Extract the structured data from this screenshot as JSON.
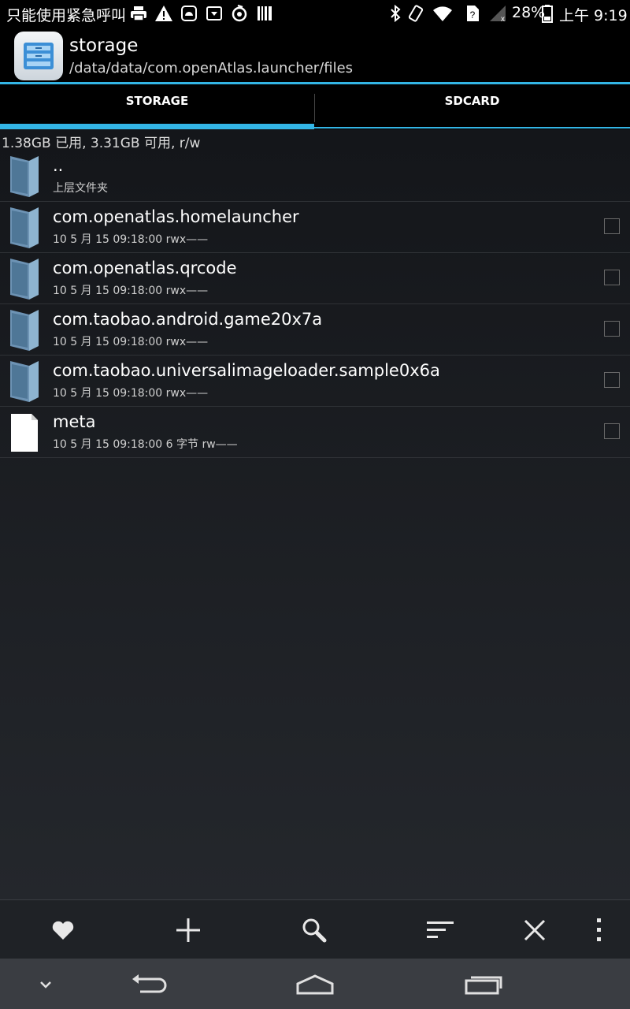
{
  "status_bar": {
    "carrier": "只能使用紧急呼叫",
    "battery": "28%",
    "time": "上午 9:19"
  },
  "action_bar": {
    "title": "storage",
    "path": "/data/data/com.openAtlas.launcher/files"
  },
  "tabs": [
    {
      "label": "STORAGE",
      "selected": true
    },
    {
      "label": "SDCARD",
      "selected": false
    }
  ],
  "storage_info": "1.38GB 已用, 3.31GB 可用, r/w",
  "files": [
    {
      "name": "..",
      "meta": "上层文件夹",
      "type": "folder",
      "checkbox": false
    },
    {
      "name": "com.openatlas.homelauncher",
      "meta": "10 5 月 15 09:18:00   rwx——",
      "type": "folder",
      "checkbox": true
    },
    {
      "name": "com.openatlas.qrcode",
      "meta": "10 5 月 15 09:18:00   rwx——",
      "type": "folder",
      "checkbox": true
    },
    {
      "name": "com.taobao.android.game20x7a",
      "meta": "10 5 月 15 09:18:00   rwx——",
      "type": "folder",
      "checkbox": true
    },
    {
      "name": "com.taobao.universalimageloader.sample0x6a",
      "meta": "10 5 月 15 09:18:00   rwx——",
      "type": "folder",
      "checkbox": true
    },
    {
      "name": "meta",
      "meta": "10 5 月 15 09:18:00  6 字节  rw——",
      "type": "file",
      "checkbox": true
    }
  ],
  "toolbar": [
    "heart-icon",
    "plus-icon",
    "search-icon",
    "sort-icon",
    "close-icon",
    "overflow-menu-icon"
  ],
  "nav": [
    "chevron-down-icon",
    "back-icon",
    "home-icon",
    "recents-icon"
  ],
  "colors": {
    "accent": "#33b5e5",
    "background": "#1a1d21"
  }
}
